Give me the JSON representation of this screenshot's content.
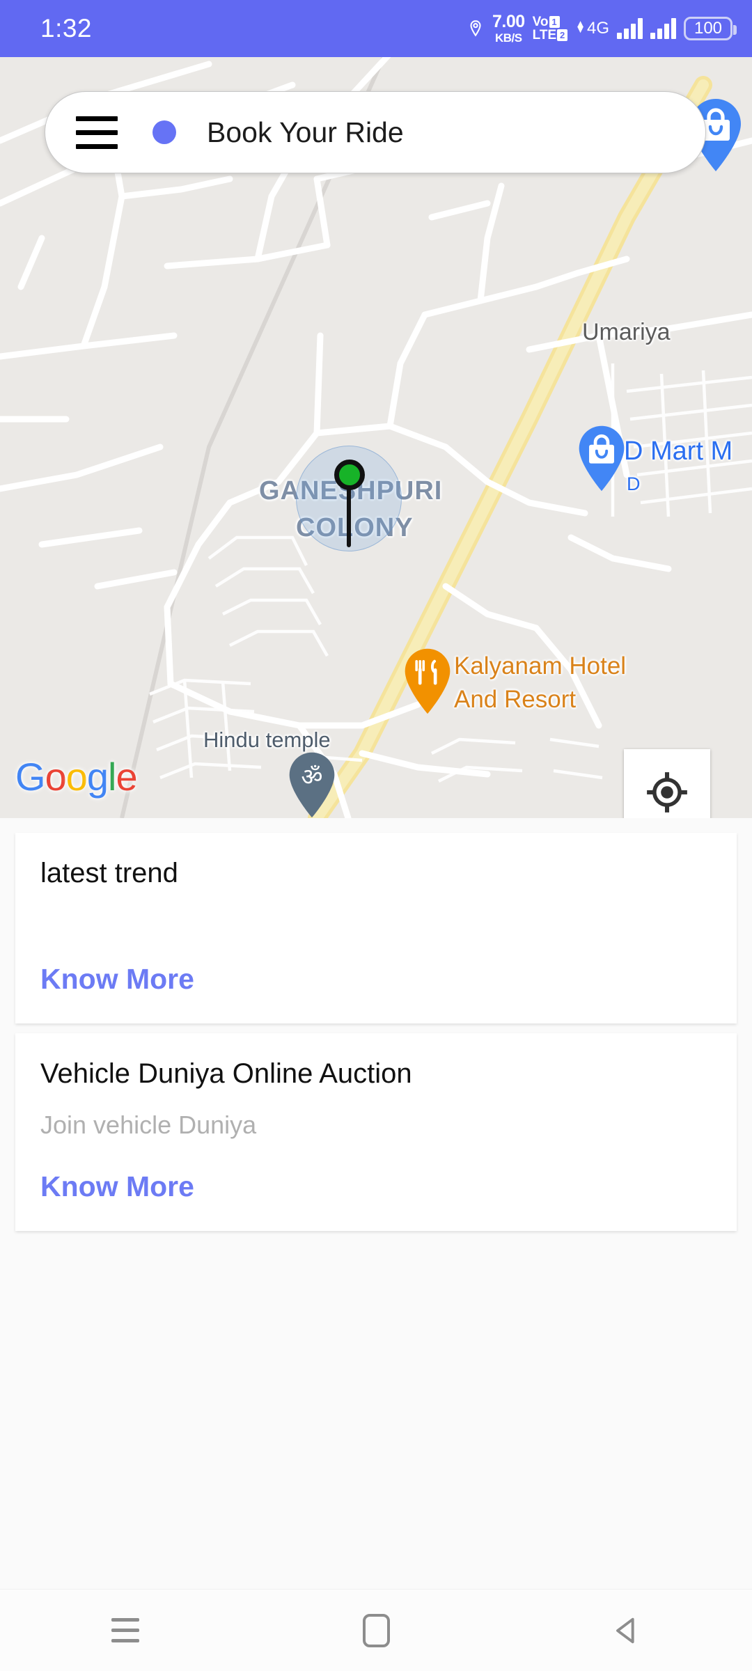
{
  "statusbar": {
    "time": "1:32",
    "location_icon": "location-pin-icon",
    "net_speed_value": "7.00",
    "net_speed_unit": "KB/S",
    "volte_line1": "Vo",
    "volte_line2": "LTE",
    "volte_sim1": "1",
    "volte_sim2": "2",
    "network_type": "4G",
    "battery_level": "100",
    "background_color": "#6169f2"
  },
  "searchbar": {
    "menu_icon": "hamburger-menu-icon",
    "dot_icon": "blue-dot-icon",
    "dot_color": "#6673f5",
    "title": "Book Your Ride"
  },
  "map": {
    "provider_logo": "Google",
    "provider_letters": [
      "G",
      "o",
      "o",
      "g",
      "l",
      "e"
    ],
    "my_location_icon": "my-location-crosshair-icon",
    "user_marker": {
      "name": "current-location-marker",
      "color": "#17b328"
    },
    "labels": [
      {
        "text": "Umariya",
        "type": "place"
      },
      {
        "text": "GANESHPURI",
        "type": "neighborhood"
      },
      {
        "text": "COLONY",
        "type": "neighborhood"
      },
      {
        "text": "D Mart M",
        "type": "poi"
      },
      {
        "text": "D",
        "type": "poi-secondary"
      },
      {
        "text": "Kalyanam Hotel",
        "type": "poi"
      },
      {
        "text": "And Resort",
        "type": "poi"
      },
      {
        "text": "Hindu temple",
        "type": "poi"
      }
    ],
    "pins": [
      {
        "name": "shopping-pin-top",
        "icon": "shopping-bag-icon",
        "color": "#4286f5"
      },
      {
        "name": "shopping-pin-dmart",
        "icon": "shopping-bag-icon",
        "color": "#4286f5"
      },
      {
        "name": "restaurant-pin-kalyanam",
        "icon": "fork-knife-icon",
        "color": "#f29100"
      },
      {
        "name": "temple-pin-hindu",
        "icon": "om-symbol-icon",
        "color": "#5b7083"
      }
    ]
  },
  "cards": [
    {
      "title": "latest trend",
      "subtitle": "",
      "link": "Know More"
    },
    {
      "title": "Vehicle Duniya Online Auction",
      "subtitle": "Join vehicle Duniya",
      "link": "Know More"
    }
  ],
  "navbar": {
    "recents_icon": "recents-icon",
    "home_icon": "home-icon",
    "back_icon": "back-triangle-icon"
  }
}
